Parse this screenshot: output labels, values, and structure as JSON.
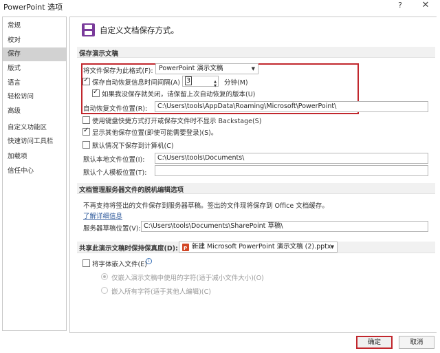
{
  "window": {
    "title": "PowerPoint 选项",
    "help_glyph": "?",
    "close_glyph": "✕"
  },
  "nav": {
    "items": [
      {
        "label": "常规"
      },
      {
        "label": "校对"
      },
      {
        "label": "保存",
        "selected": true
      },
      {
        "label": "版式"
      },
      {
        "label": "语言"
      },
      {
        "label": "轻松访问"
      },
      {
        "label": "高级"
      },
      {
        "label": "自定义功能区"
      },
      {
        "label": "快速访问工具栏"
      },
      {
        "label": "加载项"
      },
      {
        "label": "信任中心"
      }
    ]
  },
  "header": {
    "title": "自定义文档保存方式。",
    "icon": "save-disk-icon"
  },
  "save_presentations": {
    "section_title": "保存演示文稿",
    "format_label": "将文件保存为此格式(F):",
    "format_value": "PowerPoint 演示文稿",
    "autorecover_label": "保存自动恢复信息时间间隔(A)",
    "autorecover_checked": true,
    "autorecover_minutes": "3",
    "minutes_label": "分钟(M)",
    "keep_last_label": "如果我没保存就关闭，请保留上次自动恢复的版本(U)",
    "keep_last_checked": true,
    "autorecover_location_label": "自动恢复文件位置(R):",
    "autorecover_location_value": "C:\\Users\\tools\\AppData\\Roaming\\Microsoft\\PowerPoint\\",
    "no_backstage_label": "使用键盘快捷方式打开或保存文件时不显示 Backstage(S)",
    "no_backstage_checked": false,
    "show_extra_label": "显示其他保存位置(即使可能需要登录)(S)。",
    "show_extra_checked": true,
    "default_computer_label": "默认情况下保存到计算机(C)",
    "default_computer_checked": false,
    "default_local_label": "默认本地文件位置(I):",
    "default_local_value": "C:\\Users\\tools\\Documents\\",
    "default_template_label": "默认个人模板位置(T):",
    "default_template_value": ""
  },
  "offline_editing": {
    "section_title": "文档管理服务器文件的脱机编辑选项",
    "notice": "不再支持将签出的文件保存到服务器草稿。签出的文件现将保存到 Office 文档缓存。",
    "learn_more": "了解详细信息",
    "drafts_label": "服务器草稿位置(V):",
    "drafts_value": "C:\\Users\\tools\\Documents\\SharePoint 草稿\\"
  },
  "fidelity": {
    "section_title": "共享此演示文稿时保持保真度(D):",
    "file_value": "新建 Microsoft PowerPoint 演示文稿 (2).pptx",
    "embed_fonts_label": "将字体嵌入文件(E)",
    "embed_fonts_checked": false,
    "embed_subset_label": "仅嵌入演示文稿中使用的字符(适于减小文件大小)(O)",
    "embed_all_label": "嵌入所有字符(适于其他人编辑)(C)"
  },
  "footer": {
    "ok_label": "确定",
    "cancel_label": "取消"
  },
  "colors": {
    "accent_red": "#c1272d",
    "nav_selected": "#d2d2d2",
    "powerpoint_purple": "#7a3b9b"
  }
}
